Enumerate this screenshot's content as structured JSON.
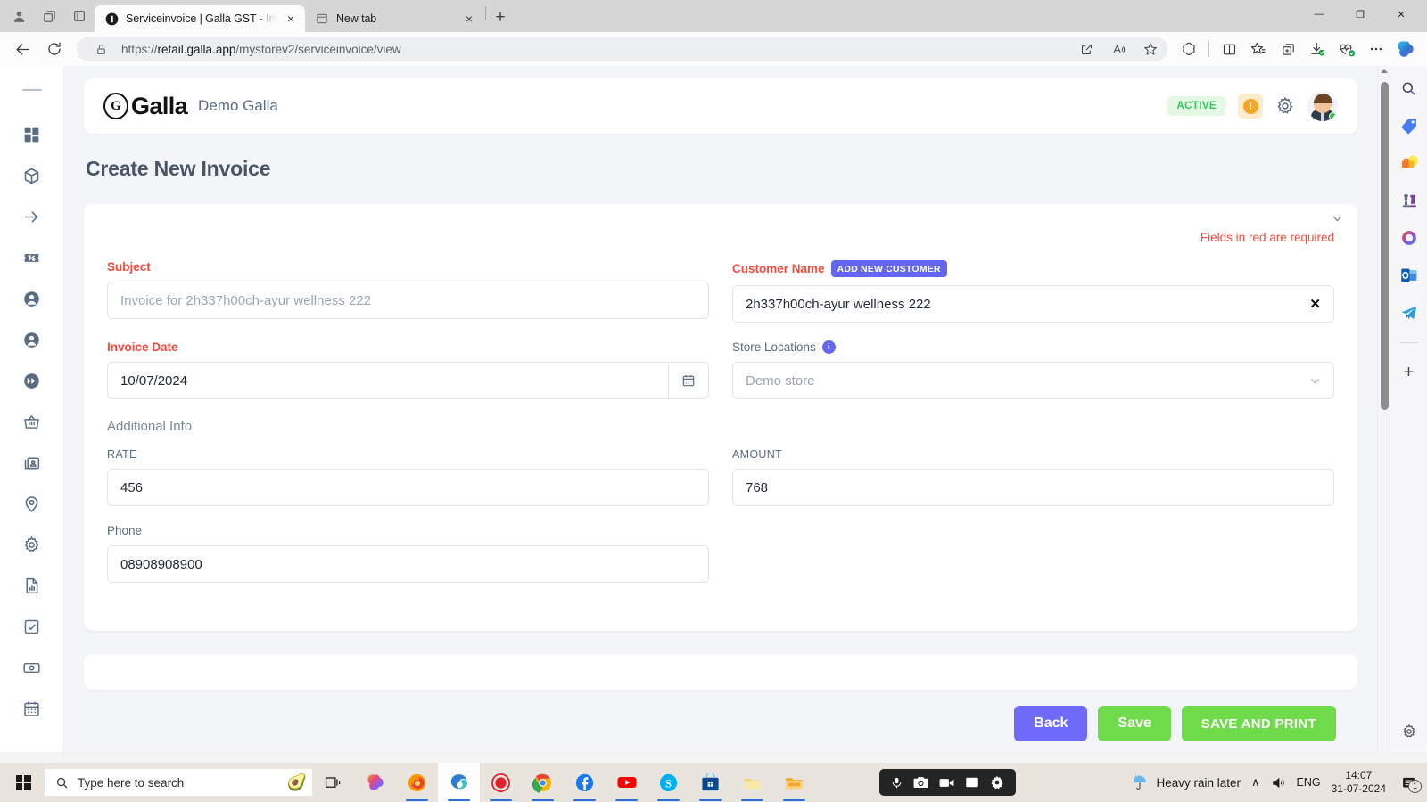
{
  "browser": {
    "tabs": [
      {
        "title": "Serviceinvoice | Galla GST - Inven",
        "favicon": "galla-favicon",
        "active": true
      },
      {
        "title": "New tab",
        "favicon": "newtab-icon",
        "active": false
      }
    ],
    "newtab_label": "+",
    "close_label": "×",
    "url_protocol": "https://",
    "url_domain": "retail.galla.app",
    "url_path": "/mystorev2/serviceinvoice/view",
    "profile_icon": "profile-icon",
    "collections_icon": "collections-icon",
    "split_icon": "tab-actions-icon",
    "back_icon": "back-arrow-icon",
    "reload_icon": "reload-icon",
    "lock_icon": "lock-icon",
    "toolbar_right_icons": [
      "open-in-app-icon",
      "read-aloud-icon",
      "favorite-star-icon",
      "copilot-icon",
      "split-screen-icon",
      "favorites-icon",
      "collections-add-icon",
      "downloads-icon",
      "browser-essentials-icon",
      "settings-more-icon",
      "copilot-sidebar-icon"
    ],
    "window_controls": {
      "minimize": "—",
      "maximize": "❐",
      "close": "✕"
    }
  },
  "app_rail": {
    "items": [
      {
        "name": "dashboard",
        "icon": "dashboard-grid-icon"
      },
      {
        "name": "products",
        "icon": "box-icon"
      },
      {
        "name": "transfer",
        "icon": "arrow-right-icon"
      },
      {
        "name": "offers",
        "icon": "discount-ticket-icon"
      },
      {
        "name": "customers",
        "icon": "user-circle-icon"
      },
      {
        "name": "suppliers",
        "icon": "user-circle-icon"
      },
      {
        "name": "quick-actions",
        "icon": "fast-forward-icon"
      },
      {
        "name": "sales",
        "icon": "basket-icon"
      },
      {
        "name": "contacts",
        "icon": "contact-card-icon"
      },
      {
        "name": "locations",
        "icon": "location-pin-icon"
      },
      {
        "name": "settings",
        "icon": "gear-icon"
      },
      {
        "name": "reports",
        "icon": "report-document-icon"
      },
      {
        "name": "tasks",
        "icon": "checkbox-icon"
      },
      {
        "name": "payments",
        "icon": "cash-icon"
      },
      {
        "name": "calendar",
        "icon": "calendar-icon"
      }
    ]
  },
  "app_header": {
    "brand_mark": "G",
    "brand_name": "Galla",
    "store_name": "Demo Galla",
    "status_badge": "ACTIVE",
    "warning_icon": "!",
    "gear_icon": "gear-icon",
    "avatar_icon": "user-avatar"
  },
  "page": {
    "title": "Create New Invoice",
    "required_note": "Fields in red are required",
    "collapse_icon": "chevron-down-icon"
  },
  "form": {
    "subject": {
      "label": "Subject",
      "placeholder": "Invoice for 2h337h00ch-ayur wellness 222",
      "value": ""
    },
    "customer_name": {
      "label": "Customer Name",
      "add_button": "ADD NEW CUSTOMER",
      "value": "2h337h00ch-ayur wellness 222",
      "clear_icon": "✕"
    },
    "invoice_date": {
      "label": "Invoice Date",
      "value": "10/07/2024",
      "calendar_icon": "calendar-icon"
    },
    "store_locations": {
      "label": "Store Locations",
      "info_icon": "i",
      "value": "Demo store",
      "chevron_icon": "chevron-down-icon"
    },
    "additional_info_heading": "Additional Info",
    "rate": {
      "label": "RATE",
      "value": "456"
    },
    "amount": {
      "label": "AMOUNT",
      "value": "768"
    },
    "phone": {
      "label": "Phone",
      "value": "08908908900"
    }
  },
  "actions": {
    "back": "Back",
    "save": "Save",
    "save_and_print": "SAVE AND PRINT"
  },
  "edge_sidebar": {
    "icons": [
      "search-icon",
      "shopping-tag-icon",
      "tools-icon",
      "games-chess-icon",
      "microsoft365-icon",
      "outlook-icon",
      "telegram-icon"
    ],
    "add_label": "+",
    "settings_icon": "gear-icon"
  },
  "taskbar": {
    "start_icon": "windows-logo-icon",
    "search_placeholder": "Type here to search",
    "search_badge_icon": "avocado-icon",
    "taskview_icon": "task-view-icon",
    "apps": [
      "copilot-icon",
      "firefox-icon",
      "edge-icon",
      "screen-recorder-icon",
      "chrome-icon",
      "facebook-icon",
      "youtube-icon",
      "skype-icon",
      "microsoft-store-icon",
      "folder-yellow-icon",
      "file-explorer-icon"
    ],
    "recorder_tools": [
      "mic-icon",
      "camera-icon",
      "video-icon",
      "screen-icon",
      "settings-icon"
    ],
    "weather_text": "Heavy rain later",
    "weather_icon": "rain-umbrella-icon",
    "tray_chevron": "∧",
    "volume_icon": "speaker-icon",
    "language": "ENG",
    "time": "14:07",
    "date": "31-07-2024",
    "notification_count": "1",
    "notification_icon": "notification-icon"
  },
  "colors": {
    "required_red": "#f5493d",
    "accent_indigo": "#6366f1",
    "success_green": "#6fdb4a",
    "active_badge_green": "#34c759",
    "page_bg": "#f4f5f9",
    "label_slate": "#5b6b82"
  }
}
